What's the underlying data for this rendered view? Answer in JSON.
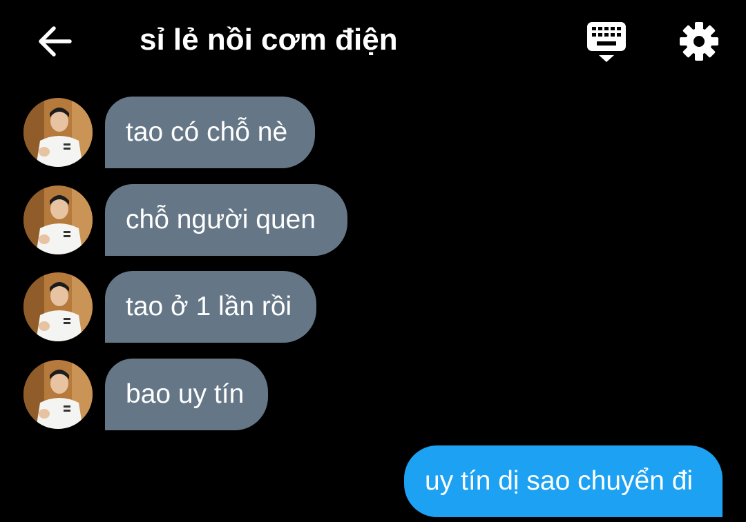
{
  "header": {
    "title": "sỉ lẻ nồi cơm điện",
    "back_icon": "arrow-left-icon",
    "keyboard_icon": "keyboard-icon",
    "settings_icon": "gear-icon"
  },
  "messages": [
    {
      "direction": "received",
      "text": "tao có chỗ nè"
    },
    {
      "direction": "received",
      "text": "chỗ người quen"
    },
    {
      "direction": "received",
      "text": "tao ở 1 lần rồi"
    },
    {
      "direction": "received",
      "text": "bao uy tín"
    },
    {
      "direction": "sent",
      "text": "uy tín dị sao chuyển đi"
    }
  ],
  "colors": {
    "background": "#000000",
    "received_bubble": "#657786",
    "sent_bubble": "#1da1f2",
    "text": "#ffffff"
  }
}
